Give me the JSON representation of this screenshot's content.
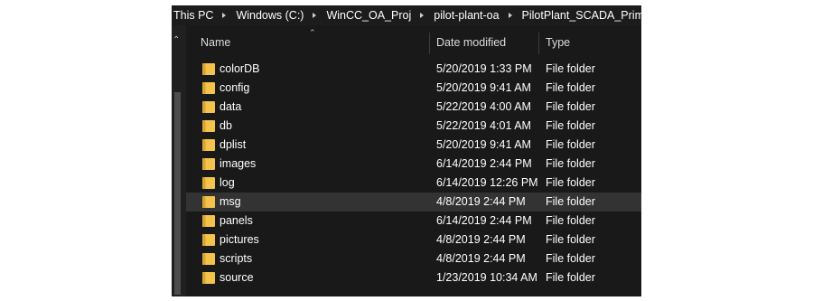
{
  "breadcrumb": [
    "This PC",
    "Windows (C:)",
    "WinCC_OA_Proj",
    "pilot-plant-oa",
    "PilotPlant_SCADA_Primary"
  ],
  "columns": {
    "name": "Name",
    "date": "Date modified",
    "type": "Type"
  },
  "sort": {
    "column": "name",
    "direction": "ascending",
    "icon": "chevron-up-icon"
  },
  "files": [
    {
      "name": "colorDB",
      "date": "5/20/2019 1:33 PM",
      "type": "File folder",
      "icon": "folder-icon"
    },
    {
      "name": "config",
      "date": "5/20/2019 9:41 AM",
      "type": "File folder",
      "icon": "folder-icon"
    },
    {
      "name": "data",
      "date": "5/22/2019 4:00 AM",
      "type": "File folder",
      "icon": "folder-icon"
    },
    {
      "name": "db",
      "date": "5/22/2019 4:01 AM",
      "type": "File folder",
      "icon": "folder-icon"
    },
    {
      "name": "dplist",
      "date": "5/20/2019 9:41 AM",
      "type": "File folder",
      "icon": "folder-icon"
    },
    {
      "name": "images",
      "date": "6/14/2019 2:44 PM",
      "type": "File folder",
      "icon": "folder-icon"
    },
    {
      "name": "log",
      "date": "6/14/2019 12:26 PM",
      "type": "File folder",
      "icon": "folder-icon"
    },
    {
      "name": "msg",
      "date": "4/8/2019 2:44 PM",
      "type": "File folder",
      "icon": "folder-icon",
      "selected": true
    },
    {
      "name": "panels",
      "date": "6/14/2019 2:44 PM",
      "type": "File folder",
      "icon": "folder-icon"
    },
    {
      "name": "pictures",
      "date": "4/8/2019 2:44 PM",
      "type": "File folder",
      "icon": "folder-icon"
    },
    {
      "name": "scripts",
      "date": "4/8/2019 2:44 PM",
      "type": "File folder",
      "icon": "folder-icon"
    },
    {
      "name": "source",
      "date": "1/23/2019 10:34 AM",
      "type": "File folder",
      "icon": "folder-icon"
    }
  ],
  "colors": {
    "background": "#191919",
    "selected_row": "#333333",
    "folder": "#f3c34c",
    "folder_dark": "#d9a532",
    "text": "#ffffff"
  }
}
